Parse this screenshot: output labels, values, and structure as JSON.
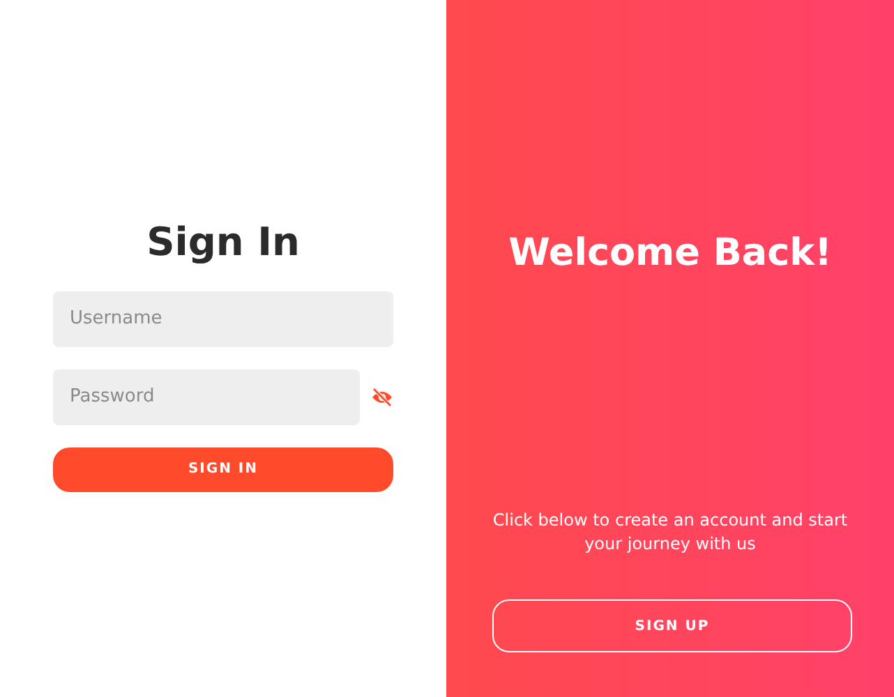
{
  "sign_in": {
    "title": "Sign In",
    "username": {
      "placeholder": "Username"
    },
    "password": {
      "placeholder": "Password",
      "visible": false
    },
    "button": "SIGN IN"
  },
  "welcome": {
    "title": "Welcome Back!",
    "message": "Click below to create an account and start your journey with us",
    "button": "SIGN UP"
  }
}
